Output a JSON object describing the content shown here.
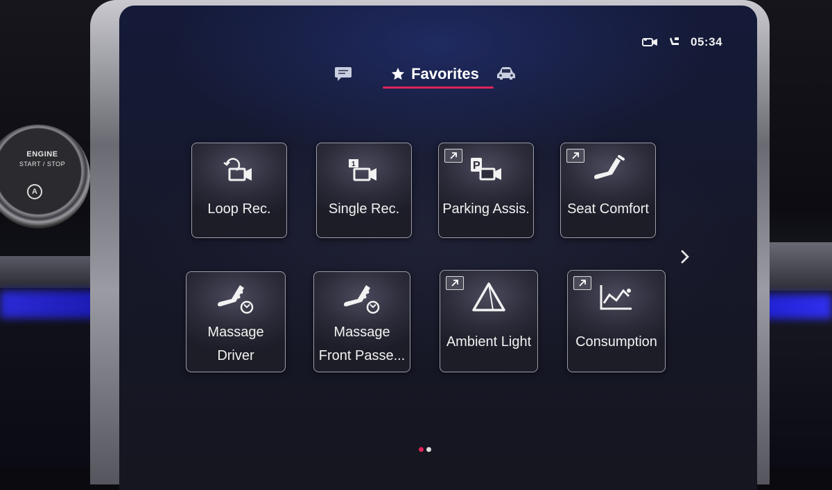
{
  "engine_button": {
    "line1": "ENGINE",
    "line2": "START / STOP",
    "icon": "auto-start-stop-icon"
  },
  "status_bar": {
    "time": "05:34",
    "icons": [
      "dashcam-icon",
      "seat-status-icon"
    ]
  },
  "tabs": {
    "items": [
      {
        "icon": "messages-icon"
      },
      {
        "icon": "star-icon",
        "label": "Favorites",
        "active": true
      },
      {
        "icon": "vehicle-icon"
      }
    ]
  },
  "favorites": {
    "tiles": [
      {
        "label": "Loop Rec.",
        "icon": "loop-record-camera-icon",
        "shortcut": false
      },
      {
        "label": "Single Rec.",
        "icon": "single-record-camera-icon",
        "shortcut": false
      },
      {
        "label": "Parking Assis.",
        "icon": "parking-camera-icon",
        "shortcut": true
      },
      {
        "label": "Seat Comfort",
        "icon": "seat-icon",
        "shortcut": true
      },
      {
        "label_line1": "Massage",
        "label_line2": "Driver",
        "icon": "massage-seat-icon",
        "shortcut": false
      },
      {
        "label_line1": "Massage",
        "label_line2": "Front Passe...",
        "icon": "massage-seat-passenger-icon",
        "shortcut": false
      },
      {
        "label": "Ambient Light",
        "icon": "ambient-light-prism-icon",
        "shortcut": true
      },
      {
        "label": "Consumption",
        "icon": "consumption-chart-icon",
        "shortcut": true
      }
    ]
  },
  "pager": {
    "current_page": 1,
    "total_pages": 2,
    "active_color": "#e0245a",
    "inactive_color": "#dddddd"
  },
  "colors": {
    "accent": "#e0245a",
    "ambient": "#2b2bd6"
  }
}
